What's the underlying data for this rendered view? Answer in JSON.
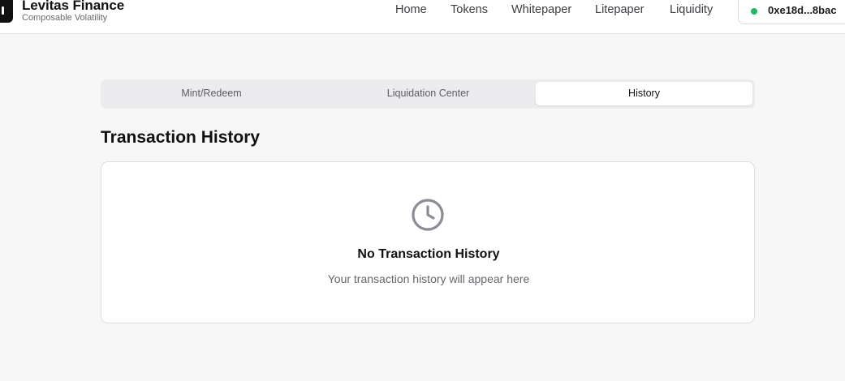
{
  "brand": {
    "name": "Levitas Finance",
    "tagline": "Composable Volatility"
  },
  "nav": {
    "items": [
      "Home",
      "Tokens",
      "Whitepaper",
      "Litepaper",
      "Liquidity"
    ]
  },
  "wallet": {
    "address": "0xe18d...8bac",
    "status_color": "#16c060"
  },
  "tabs": [
    {
      "label": "Mint/Redeem",
      "active": false
    },
    {
      "label": "Liquidation Center",
      "active": false
    },
    {
      "label": "History",
      "active": true
    }
  ],
  "page": {
    "title": "Transaction History"
  },
  "empty_state": {
    "icon": "clock-icon",
    "title": "No Transaction History",
    "subtitle": "Your transaction history will appear here"
  }
}
